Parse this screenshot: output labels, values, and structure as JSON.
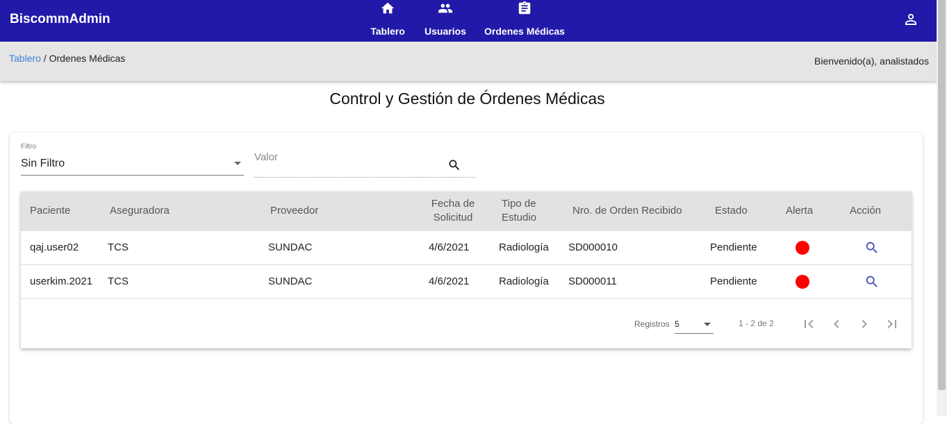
{
  "app": {
    "brand": "BiscommAdmin"
  },
  "nav": {
    "items": [
      {
        "label": "Tablero",
        "icon": "home-icon"
      },
      {
        "label": "Usuarios",
        "icon": "users-icon"
      },
      {
        "label": "Ordenes Médicas",
        "icon": "clipboard-icon"
      }
    ],
    "user_icon": "account-icon"
  },
  "breadcrumb": {
    "link": "Tablero",
    "separator": " / ",
    "current": "Ordenes Médicas"
  },
  "welcome": "Bienvenido(a), analistados",
  "page_title": "Control y Gestión de Órdenes Médicas",
  "filter": {
    "label": "Filtro",
    "value": "Sin Filtro"
  },
  "search": {
    "placeholder": "Valor",
    "value": ""
  },
  "table": {
    "headers": {
      "paciente": "Paciente",
      "aseguradora": "Aseguradora",
      "proveedor": "Proveedor",
      "fecha_l1": "Fecha de",
      "fecha_l2": "Solicitud",
      "tipo_l1": "Tipo de",
      "tipo_l2": "Estudio",
      "orden": "Nro. de Orden Recibido",
      "estado": "Estado",
      "alerta": "Alerta",
      "accion": "Acción"
    },
    "rows": [
      {
        "paciente": "qaj.user02",
        "aseguradora": "TCS",
        "proveedor": "SUNDAC",
        "fecha": "4/6/2021",
        "tipo": "Radiología",
        "orden": "SD000010",
        "estado": "Pendiente",
        "alerta_color": "#ff0000"
      },
      {
        "paciente": "userkim.2021",
        "aseguradora": "TCS",
        "proveedor": "SUNDAC",
        "fecha": "4/6/2021",
        "tipo": "Radiología",
        "orden": "SD000011",
        "estado": "Pendiente",
        "alerta_color": "#ff0000"
      }
    ]
  },
  "pagination": {
    "label": "Registros",
    "page_size": "5",
    "range": "1 - 2 de 2"
  },
  "colors": {
    "primary": "#2219a8",
    "link": "#3f7fd9",
    "action_icon": "#3f51b5",
    "alert": "#ff0000"
  }
}
